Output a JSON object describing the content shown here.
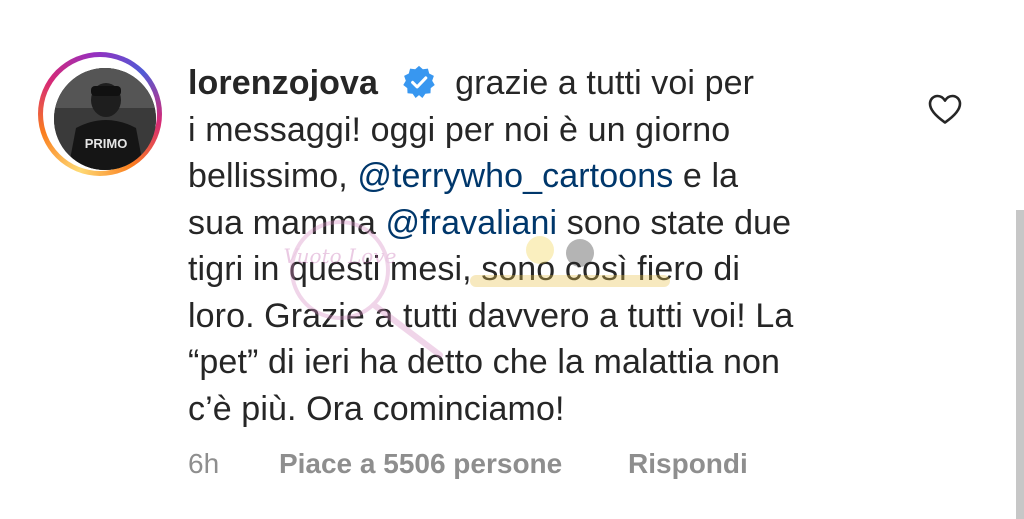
{
  "comment": {
    "username": "lorenzojova",
    "verified_icon": "verified-badge-icon",
    "lines": [
      "grazie a tutti voi per",
      "i messaggi! oggi per noi è un giorno",
      "bellissimo,",
      "@terrywho_cartoons",
      "e la",
      "sua mamma",
      "@fravaliani",
      "sono state due",
      "tigri in questi mesi, sono così fiero di",
      "loro. Grazie a tutti davvero a tutti voi! La",
      "“pet” di ieri ha detto che la malattia non",
      "c’è più. Ora cominciamo!"
    ],
    "avatar_text": "PRIMO"
  },
  "meta": {
    "time": "6h",
    "likes": "Piace a 5506 persone",
    "reply": "Rispondi"
  },
  "watermark": {
    "text": "Vuoto Love"
  },
  "colors": {
    "text": "#262626",
    "mention": "#00376b",
    "meta": "#8e8e8e",
    "verified": "#3897f0"
  },
  "icons": {
    "like": "heart-outline-icon"
  }
}
